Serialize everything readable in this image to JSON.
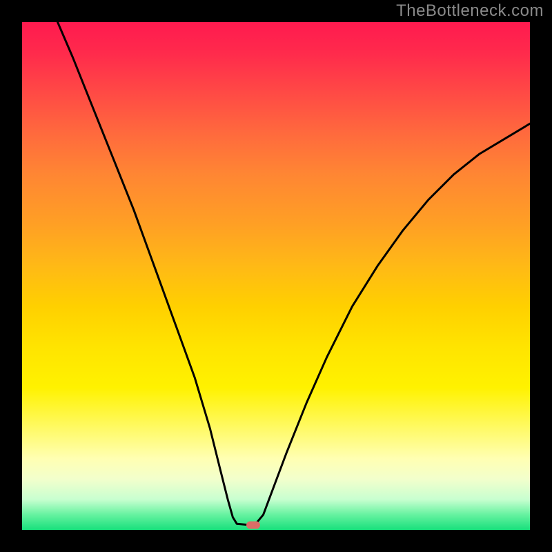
{
  "watermark": "TheBottleneck.com",
  "chart_data": {
    "type": "line",
    "title": "",
    "xlabel": "",
    "ylabel": "",
    "xlim": [
      0,
      100
    ],
    "ylim": [
      0,
      100
    ],
    "curve": {
      "left": [
        {
          "x": 7,
          "y": 100
        },
        {
          "x": 10,
          "y": 93
        },
        {
          "x": 14,
          "y": 83
        },
        {
          "x": 18,
          "y": 73
        },
        {
          "x": 22,
          "y": 63
        },
        {
          "x": 26,
          "y": 52
        },
        {
          "x": 30,
          "y": 41
        },
        {
          "x": 34,
          "y": 30
        },
        {
          "x": 37,
          "y": 20
        },
        {
          "x": 39,
          "y": 12
        },
        {
          "x": 40.5,
          "y": 6
        },
        {
          "x": 41.5,
          "y": 2.5
        },
        {
          "x": 42.3,
          "y": 1.2
        }
      ],
      "flat": [
        {
          "x": 42.3,
          "y": 1.2
        },
        {
          "x": 44.5,
          "y": 1.0
        },
        {
          "x": 46.0,
          "y": 1.2
        }
      ],
      "right": [
        {
          "x": 46.0,
          "y": 1.2
        },
        {
          "x": 47.5,
          "y": 3
        },
        {
          "x": 49,
          "y": 7
        },
        {
          "x": 52,
          "y": 15
        },
        {
          "x": 56,
          "y": 25
        },
        {
          "x": 60,
          "y": 34
        },
        {
          "x": 65,
          "y": 44
        },
        {
          "x": 70,
          "y": 52
        },
        {
          "x": 75,
          "y": 59
        },
        {
          "x": 80,
          "y": 65
        },
        {
          "x": 85,
          "y": 70
        },
        {
          "x": 90,
          "y": 74
        },
        {
          "x": 95,
          "y": 77
        },
        {
          "x": 100,
          "y": 80
        }
      ]
    },
    "marker": {
      "x": 45.5,
      "y": 1.0
    },
    "colors": {
      "curve": "#000000",
      "marker": "#db6e67",
      "gradient_top": "#ff1a4f",
      "gradient_bottom": "#18e07c",
      "background": "#000000"
    }
  }
}
